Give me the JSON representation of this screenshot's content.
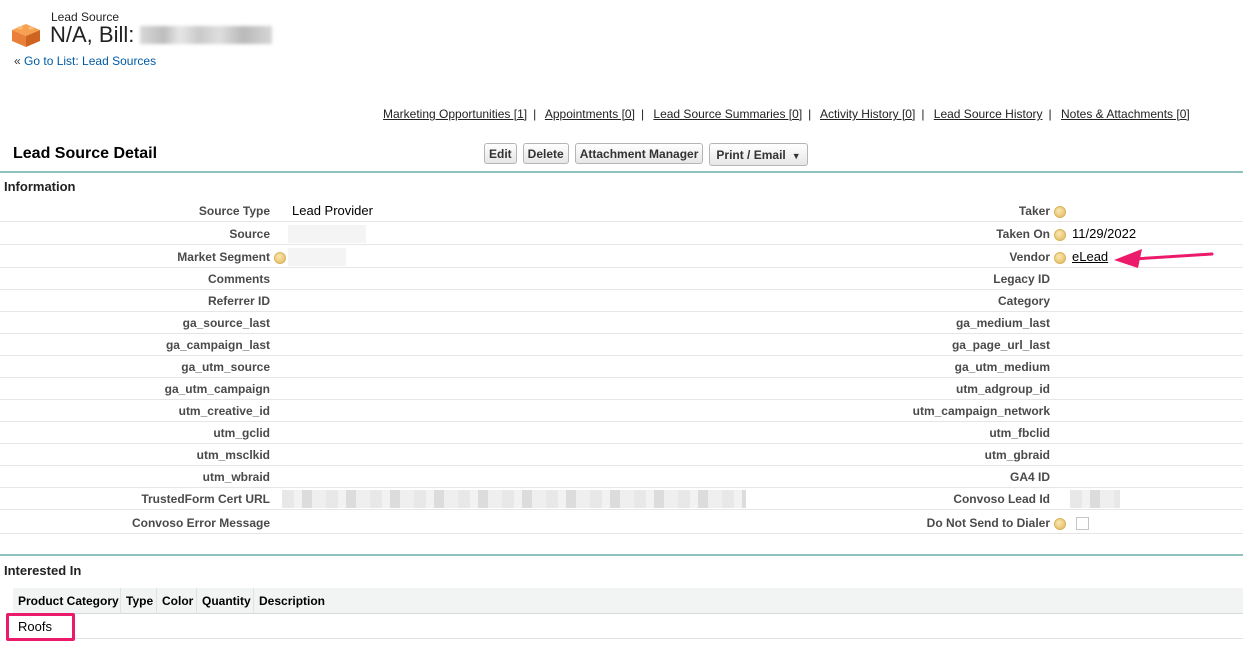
{
  "header": {
    "object_type": "Lead Source",
    "record_name": "N/A, Bill:",
    "back_prefix": "«",
    "back_link": "Go to List: Lead Sources"
  },
  "related_lists": [
    "Marketing Opportunities [1]",
    "Appointments [0]",
    "Lead Source Summaries [0]",
    "Activity History [0]",
    "Lead Source History",
    "Notes & Attachments [0]"
  ],
  "detail": {
    "title": "Lead Source Detail",
    "buttons": {
      "edit": "Edit",
      "delete": "Delete",
      "attachment_manager": "Attachment Manager",
      "print_email": "Print / Email"
    }
  },
  "information": {
    "section_title": "Information",
    "left": [
      {
        "label": "Source Type",
        "value": "Lead Provider"
      },
      {
        "label": "Source",
        "value": ""
      },
      {
        "label": "Market Segment",
        "value": ""
      },
      {
        "label": "Comments",
        "value": ""
      },
      {
        "label": "Referrer ID",
        "value": ""
      },
      {
        "label": "ga_source_last",
        "value": ""
      },
      {
        "label": "ga_campaign_last",
        "value": ""
      },
      {
        "label": "ga_utm_source",
        "value": ""
      },
      {
        "label": "ga_utm_campaign",
        "value": ""
      },
      {
        "label": "utm_creative_id",
        "value": ""
      },
      {
        "label": "utm_gclid",
        "value": ""
      },
      {
        "label": "utm_msclkid",
        "value": ""
      },
      {
        "label": "utm_wbraid",
        "value": ""
      },
      {
        "label": "TrustedForm Cert URL",
        "value": ""
      },
      {
        "label": "Convoso Error Message",
        "value": ""
      }
    ],
    "right": [
      {
        "label": "Taker",
        "value": ""
      },
      {
        "label": "Taken On",
        "value": "11/29/2022"
      },
      {
        "label": "Vendor",
        "value": "eLead"
      },
      {
        "label": "Legacy ID",
        "value": ""
      },
      {
        "label": "Category",
        "value": ""
      },
      {
        "label": "ga_medium_last",
        "value": ""
      },
      {
        "label": "ga_page_url_last",
        "value": ""
      },
      {
        "label": "ga_utm_medium",
        "value": ""
      },
      {
        "label": "utm_adgroup_id",
        "value": ""
      },
      {
        "label": "utm_campaign_network",
        "value": ""
      },
      {
        "label": "utm_fbclid",
        "value": ""
      },
      {
        "label": "utm_gbraid",
        "value": ""
      },
      {
        "label": "GA4 ID",
        "value": ""
      },
      {
        "label": "Convoso Lead Id",
        "value": ""
      },
      {
        "label": "Do Not Send to Dialer",
        "value": ""
      }
    ]
  },
  "interested_in": {
    "section_title": "Interested In",
    "columns": [
      "Product Category",
      "Type",
      "Color",
      "Quantity",
      "Description"
    ],
    "rows": [
      [
        "Roofs",
        "",
        "",
        "",
        ""
      ]
    ]
  },
  "colors": {
    "link": "#015ba7",
    "section_line": "#8fc1bd",
    "highlight": "#ec1a6a"
  }
}
